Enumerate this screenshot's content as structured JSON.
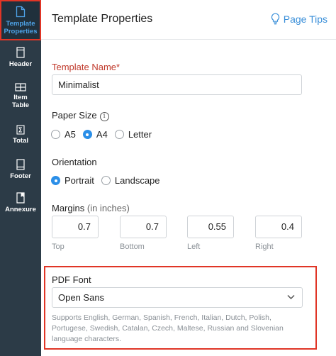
{
  "sidebar": {
    "items": [
      {
        "label_line1": "Template",
        "label_line2": "Properties",
        "icon": "document-icon",
        "active": true
      },
      {
        "label_line1": "Header",
        "label_line2": "",
        "icon": "header-icon"
      },
      {
        "label_line1": "Item",
        "label_line2": "Table",
        "icon": "table-icon"
      },
      {
        "label_line1": "Total",
        "label_line2": "",
        "icon": "sigma-icon"
      },
      {
        "label_line1": "Footer",
        "label_line2": "",
        "icon": "footer-icon"
      },
      {
        "label_line1": "Annexure",
        "label_line2": "",
        "icon": "annexure-icon"
      }
    ]
  },
  "header": {
    "title": "Template Properties",
    "tips_label": "Page Tips",
    "tips_icon": "lightbulb-icon"
  },
  "template_name": {
    "label": "Template Name*",
    "value": "Minimalist"
  },
  "paper_size": {
    "label": "Paper Size",
    "info_icon": "info-icon",
    "options": [
      "A5",
      "A4",
      "Letter"
    ],
    "selected": "A4"
  },
  "orientation": {
    "label": "Orientation",
    "options": [
      "Portrait",
      "Landscape"
    ],
    "selected": "Portrait"
  },
  "margins": {
    "label": "Margins",
    "unit_note": "(in inches)",
    "top": {
      "label": "Top",
      "value": "0.7"
    },
    "bottom": {
      "label": "Bottom",
      "value": "0.7"
    },
    "left": {
      "label": "Left",
      "value": "0.55"
    },
    "right": {
      "label": "Right",
      "value": "0.4"
    }
  },
  "pdf_font": {
    "label": "PDF Font",
    "selected": "Open Sans",
    "help": "Supports English, German, Spanish, French, Italian, Dutch, Polish, Portugese, Swedish, Catalan, Czech, Maltese, Russian and Slovenian language characters."
  },
  "colors": {
    "sidebar_bg": "#2c3b47",
    "accent_blue": "#2b8fe8",
    "highlight_red": "#e03526",
    "required_red": "#c0392b"
  }
}
